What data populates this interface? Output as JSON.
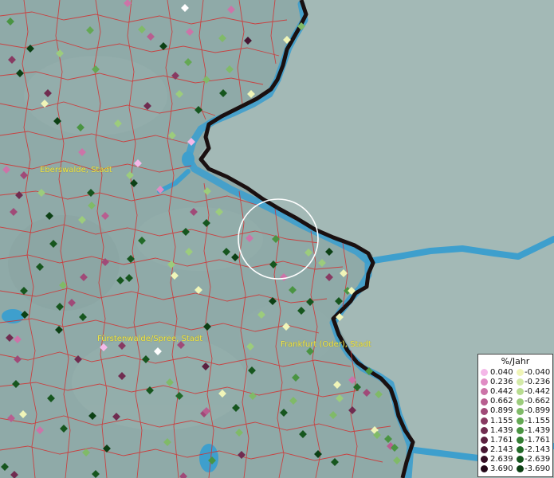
{
  "map": {
    "colors": {
      "land": "#8faaa8",
      "poland": "#a3b9b6",
      "water": "#3e9fcd",
      "admin_border": "#d23030",
      "national_border": "#1a1010",
      "cursor": "#ffffff"
    },
    "cities": [
      {
        "name": "Eberswalde, Stadt"
      },
      {
        "name": "Fürstenwalde/Spree, Stadt"
      },
      {
        "name": "Frankfurt (Oder), Stadt"
      }
    ]
  },
  "legend": {
    "title": "%/Jahr",
    "rows": [
      {
        "pos": "0.040",
        "neg": "-0.040",
        "pos_color": "#f4b8e8",
        "neg_color": "#f0f5b8"
      },
      {
        "pos": "0.236",
        "neg": "-0.236",
        "pos_color": "#e08cc4",
        "neg_color": "#d4eaa8"
      },
      {
        "pos": "0.442",
        "neg": "-0.442",
        "pos_color": "#cc74a8",
        "neg_color": "#b8dc90"
      },
      {
        "pos": "0.662",
        "neg": "-0.662",
        "pos_color": "#b85e90",
        "neg_color": "#9ccc7c"
      },
      {
        "pos": "0.899",
        "neg": "-0.899",
        "pos_color": "#a04a78",
        "neg_color": "#80ba68"
      },
      {
        "pos": "1.155",
        "neg": "-1.155",
        "pos_color": "#883a62",
        "neg_color": "#64a854"
      },
      {
        "pos": "1.439",
        "neg": "-1.439",
        "pos_color": "#702c50",
        "neg_color": "#4a9442"
      },
      {
        "pos": "1.761",
        "neg": "-1.761",
        "pos_color": "#5c2040",
        "neg_color": "#347e34"
      },
      {
        "pos": "2.143",
        "neg": "-2.143",
        "pos_color": "#481632",
        "neg_color": "#226a28"
      },
      {
        "pos": "2.639",
        "neg": "-2.639",
        "pos_color": "#360e24",
        "neg_color": "#16561e"
      },
      {
        "pos": "3.690",
        "neg": "-3.690",
        "pos_color": "#240818",
        "neg_color": "#0c4014"
      }
    ]
  }
}
